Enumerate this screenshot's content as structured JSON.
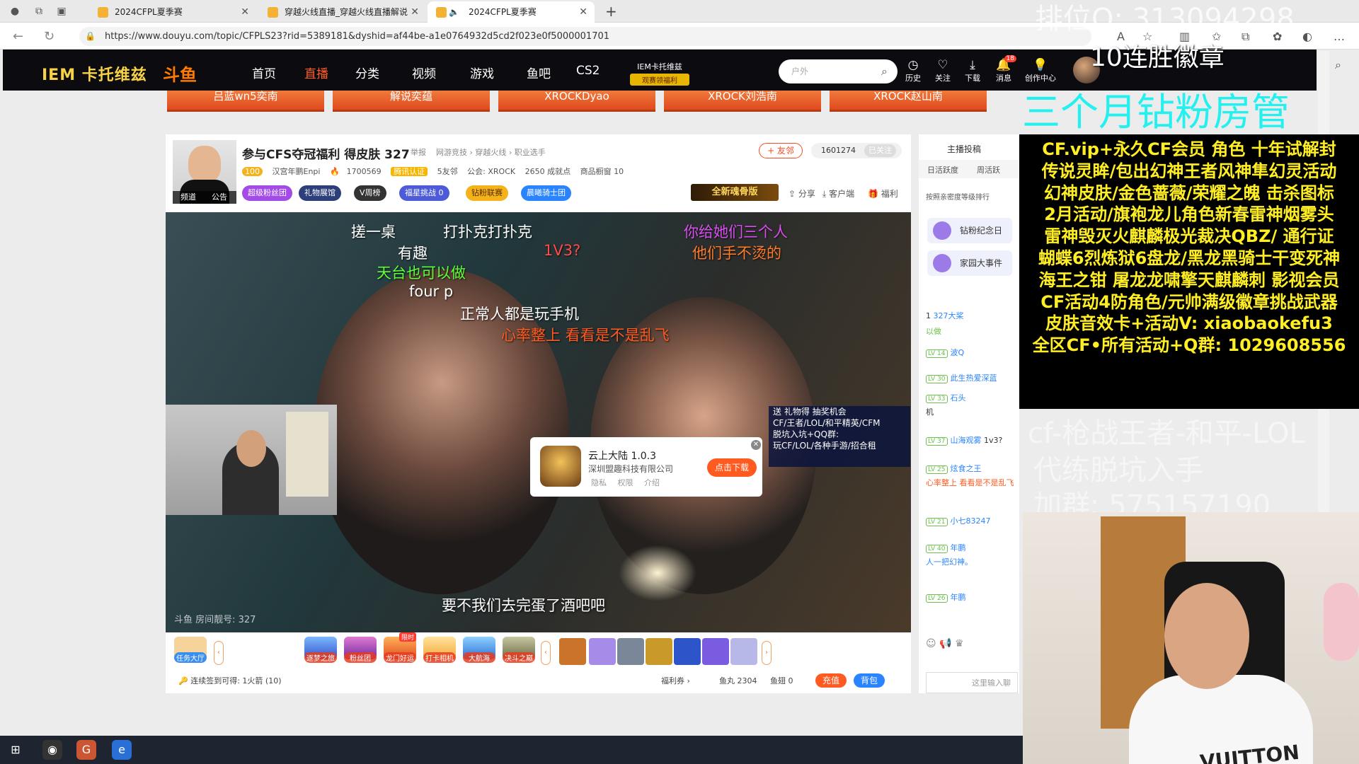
{
  "browser": {
    "tabs": [
      {
        "title": "2024CFPL夏季赛",
        "active": false
      },
      {
        "title": "穿越火线直播_穿越火线直播解说",
        "active": false
      },
      {
        "title": "2024CFPL夏季赛",
        "active": true
      }
    ],
    "url": "https://www.douyu.com/topic/CFPLS23?rid=5389181&dyshid=af44be-a1e0764932d5cd2f023e0f5000001701"
  },
  "header": {
    "brand": "IEM 卡托维兹",
    "logo": "斗鱼",
    "nav": [
      "首页",
      "直播",
      "分类",
      "视频",
      "游戏",
      "鱼吧",
      "CS2"
    ],
    "iem_title": "IEM卡托维兹",
    "iem_sub": "观赛领福利",
    "search_placeholder": "户外",
    "tools": [
      {
        "label": "历史",
        "icon": "clock-icon"
      },
      {
        "label": "关注",
        "icon": "heart-icon"
      },
      {
        "label": "下载",
        "icon": "download-icon"
      },
      {
        "label": "消息",
        "icon": "bell-icon",
        "badge": "18"
      },
      {
        "label": "创作中心",
        "icon": "bulb-icon"
      }
    ]
  },
  "banners": [
    "吕蓝wn5奕南",
    "解说奕蕴",
    "XROCKDyao",
    "XROCK刘浩南",
    "XROCK赵山南"
  ],
  "room": {
    "title": "参与CFS夺冠福利 得皮肤 327",
    "report": "举报",
    "crumbs": "网游竞技 › 穿越火线 › 职业选手",
    "level": "100",
    "streamer": "汉宫年鹏Enpi",
    "hot": "1700569",
    "cert": "腾讯认证",
    "neighbors": "5友邻",
    "guild": "公会: XROCK",
    "achieve": "2650 成就点",
    "shop": "商品橱窗 10",
    "friend_btn": "+ 友邻",
    "followers": "1601274",
    "follow_state": "已关注",
    "avatar_tabs": [
      "频道",
      "公告"
    ],
    "chips": [
      "超级粉丝团",
      "礼物展馆",
      "V周榜",
      "福星挑战 0",
      "钻粉联赛",
      "晨曦骑士团"
    ],
    "promo": "全新魂骨版",
    "actions": [
      "分享",
      "客户端",
      "福利"
    ]
  },
  "video": {
    "danmu": [
      {
        "text": "搓一桌",
        "color": "#ffffff"
      },
      {
        "text": "打扑克打扑克",
        "color": "#ffffff"
      },
      {
        "text": "有趣",
        "color": "#ffffff"
      },
      {
        "text": "1V3?",
        "color": "#ff4a4a"
      },
      {
        "text": "天台也可以做",
        "color": "#5cff3a"
      },
      {
        "text": "four p",
        "color": "#ffffff"
      },
      {
        "text": "正常人都是玩手机",
        "color": "#ffffff"
      },
      {
        "text": "心率整上 看看是不是乱飞",
        "color": "#ff5a1f"
      },
      {
        "text": "你给她们三个人",
        "color": "#d94ef0"
      },
      {
        "text": "他们手不烫的",
        "color": "#ff7a2a"
      }
    ],
    "subtitle": "要不我们去完蛋了酒吧吧",
    "room_no": "斗鱼 房间靓号: 327",
    "promo_lines": [
      "送 礼物得 抽奖机会",
      "CF/王者/LOL/和平精英/CFM",
      "脱坑入坑+QQ群:",
      "玩CF/LOL/各种手游/招合租"
    ],
    "ad": {
      "title": "云上大陆 1.0.3",
      "company": "深圳盟趣科技有限公司",
      "links": [
        "隐私",
        "权限",
        "介绍"
      ],
      "button": "点击下载"
    }
  },
  "gifts": {
    "items": [
      "任务大厅",
      "逐梦之旅",
      "粉丝团",
      "龙门好运",
      "打卡相机",
      "大航海",
      "决斗之巅"
    ],
    "limited": "限时",
    "sign": "连续签到可得: 1火箭 (10)",
    "coupon": "福利券",
    "fish_balls": "鱼丸 2304",
    "fish_fins": "鱼翅 0",
    "recharge": "充值",
    "backpack": "背包"
  },
  "chat": {
    "header": "主播投稿",
    "tabs": [
      "日活跃度",
      "周活跃"
    ],
    "note": "按照亲密度等级排行",
    "cards": [
      "钻粉纪念日",
      "家园大事件"
    ],
    "rank_name": "327大桨",
    "messages": [
      {
        "lv": "",
        "name": "",
        "text": "以做"
      },
      {
        "lv": "LV 14",
        "name": "波Q",
        "text": ""
      },
      {
        "lv": "LV 30",
        "name": "此生热爱深蓝",
        "text": ""
      },
      {
        "lv": "LV 33",
        "name": "石头",
        "text": "机"
      },
      {
        "lv": "LV 37",
        "name": "山海观雾",
        "text": "1v3?"
      },
      {
        "lv": "LV 25",
        "name": "炫食之王",
        "text": "心率整上 看看是不是乱飞"
      },
      {
        "lv": "LV 21",
        "name": "小七83247",
        "text": ""
      },
      {
        "lv": "LV 40",
        "name": "年鹏",
        "text": "人一把幻神。"
      },
      {
        "lv": "LV 26",
        "name": "年鹏",
        "text": ""
      }
    ],
    "input_placeholder": "这里输入聊天"
  },
  "overlay": {
    "rank_qq": "排位Q: 313094298",
    "win_badge": "10连胜徽章",
    "fans_manager": "三个月钻粉房管",
    "promo_lines": [
      "CF.vip+永久CF会员 角色 十年试解封",
      "传说灵眸/包出幻神王者风神隼幻灵活动",
      "幻神皮肤/金色蔷薇/荣耀之魄 击杀图标",
      "2月活动/旗袍龙儿角色新春雷神烟雾头",
      "雷神毁灭火麒麟极光裁决QBZ/ 通行证",
      "蝴蝶6烈炼狱6盘龙/黑龙黑骑士干变死神",
      "海王之钳 屠龙龙啸擎天麒麟刺 影视会员",
      "CF活动4防角色/元帅满级徽章挑战武器",
      "皮肤音效卡+活动V: xiaobaokefu3",
      "全区CF•所有活动+Q群: 1029608556"
    ],
    "ghost_lines": [
      "cf-枪战王者-和平-LOL",
      "代练脱坑入手",
      "加群: 575157190"
    ],
    "tee_logo": "VUITTON"
  }
}
